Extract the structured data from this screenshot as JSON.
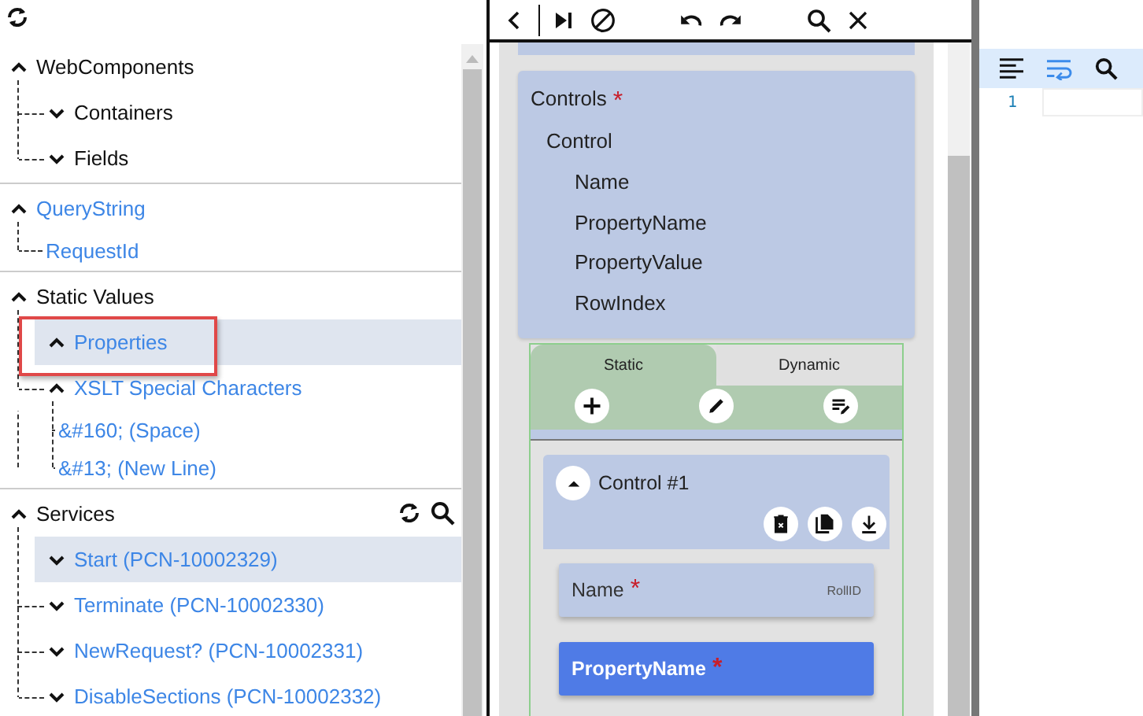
{
  "tree": [
    {
      "label": "WebComponents",
      "kind": "category",
      "expanded": true,
      "selected": false,
      "tools": false,
      "children": [
        {
          "label": "Containers",
          "kind": "category",
          "expanded": false,
          "selected": false
        },
        {
          "label": "Fields",
          "kind": "category",
          "expanded": false,
          "selected": false
        }
      ]
    },
    {
      "label": "QueryString",
      "kind": "link",
      "expanded": true,
      "selected": false,
      "tools": false,
      "children": [
        {
          "label": "RequestId",
          "kind": "link",
          "selected": false
        }
      ]
    },
    {
      "label": "Static Values",
      "kind": "category",
      "expanded": true,
      "selected": false,
      "tools": false,
      "children": [
        {
          "label": "Properties",
          "kind": "link",
          "expanded": true,
          "selected": true,
          "annotated": true
        },
        {
          "label": "XSLT Special Characters",
          "kind": "link",
          "expanded": true,
          "selected": false,
          "children": [
            {
              "label": "&#160; (Space)",
              "kind": "link",
              "selected": false
            },
            {
              "label": "&#13; (New Line)",
              "kind": "link",
              "selected": false
            }
          ]
        }
      ]
    },
    {
      "label": "Services",
      "kind": "category",
      "expanded": true,
      "selected": false,
      "tools": true,
      "children": [
        {
          "label": "Start (PCN-10002329)",
          "kind": "link",
          "expanded": false,
          "selected": true
        },
        {
          "label": "Terminate (PCN-10002330)",
          "kind": "link",
          "expanded": false,
          "selected": false
        },
        {
          "label": "NewRequest? (PCN-10002331)",
          "kind": "link",
          "expanded": false,
          "selected": false
        },
        {
          "label": "DisableSections (PCN-10002332)",
          "kind": "link",
          "expanded": false,
          "selected": false
        }
      ]
    }
  ],
  "schema": {
    "title": "Controls",
    "required_mark": "*",
    "fields": [
      {
        "label": "Control",
        "children": [
          {
            "label": "Name"
          },
          {
            "label": "PropertyName"
          },
          {
            "label": "PropertyValue"
          },
          {
            "label": "RowIndex"
          }
        ]
      }
    ]
  },
  "tabs": [
    {
      "label": "Static",
      "selected": true
    },
    {
      "label": "Dynamic",
      "selected": false
    }
  ],
  "control_card": {
    "title": "Control #1",
    "expanded": true,
    "fields": [
      {
        "label": "Name",
        "required_mark": "*",
        "value": "RollID",
        "focused": false
      },
      {
        "label": "PropertyName",
        "required_mark": "*",
        "focused": true
      }
    ]
  },
  "editor": {
    "line_numbers": [
      "1"
    ]
  }
}
